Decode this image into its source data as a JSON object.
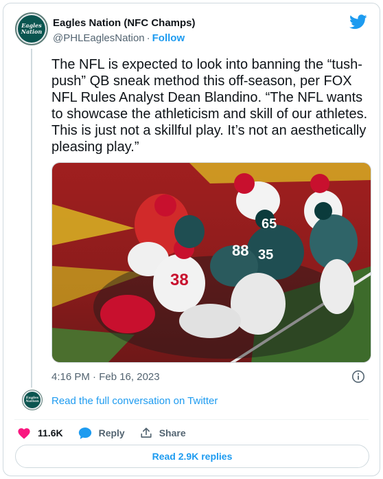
{
  "author": {
    "name": "Eagles Nation (NFC Champs)",
    "handle": "@PHLEaglesNation",
    "separator": "·",
    "follow_label": "Follow",
    "avatar_text_line1": "Eagles",
    "avatar_text_line2": "Nation"
  },
  "tweet": {
    "text": "The NFL is expected to look into banning the “tush-push” QB sneak method this off-season, per FOX NFL Rules Analyst Dean Blandino. “The NFL wants to showcase the athleticism and skill of our athletes. This is just not a skillful play. It’s not an aesthetically pleasing play.”",
    "timestamp": "4:16 PM · Feb 16, 2023",
    "photo_jersey_numbers": [
      "88",
      "65",
      "35",
      "38"
    ]
  },
  "conversation_link": "Read the full conversation on Twitter",
  "actions": {
    "likes": "11.6K",
    "reply_label": "Reply",
    "share_label": "Share"
  },
  "replies_button": "Read 2.9K replies",
  "colors": {
    "accent": "#1d9bf0",
    "like": "#f91880",
    "muted_text": "#536471",
    "border": "#cfd9de",
    "eagles_green": "#0b5550"
  },
  "icons": [
    "twitter-bird-icon",
    "info-icon",
    "heart-icon",
    "reply-bubble-icon",
    "share-icon"
  ]
}
